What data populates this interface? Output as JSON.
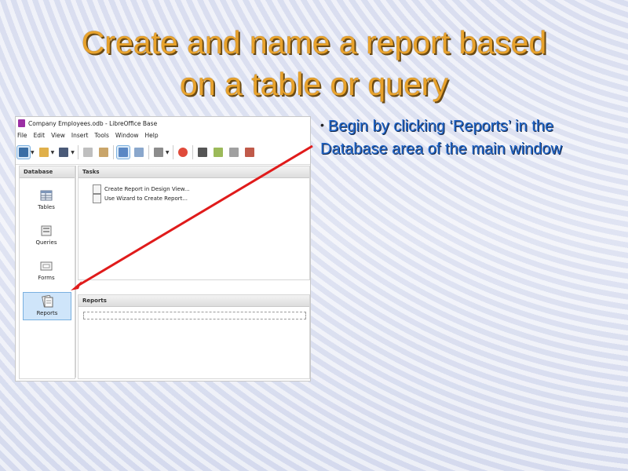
{
  "slide": {
    "title_line1": "Create and name a report based",
    "title_line2": "on a table or query",
    "bullet": "Begin by clicking ‘Reports’ in the Database area of the main window",
    "bullet_marker": "•",
    "accent_color": "#e8a22c",
    "bullet_color": "#1d63c7",
    "arrow_color": "#e01b1b"
  },
  "window": {
    "title": "Company Employees.odb - LibreOffice Base",
    "menu": [
      "File",
      "Edit",
      "View",
      "Insert",
      "Tools",
      "Window",
      "Help"
    ],
    "toolbar_icons": [
      "new-document-icon",
      "open-folder-icon",
      "save-icon",
      "copy-icon",
      "paste-icon",
      "sort-ascending-icon",
      "sort-icon",
      "form-icon",
      "help-icon",
      "report-icon",
      "edit-icon",
      "open-icon",
      "delete-icon"
    ]
  },
  "database_pane": {
    "header": "Database",
    "items": [
      {
        "label": "Tables",
        "icon": "tables-icon",
        "selected": false
      },
      {
        "label": "Queries",
        "icon": "queries-icon",
        "selected": false
      },
      {
        "label": "Forms",
        "icon": "forms-icon",
        "selected": false
      },
      {
        "label": "Reports",
        "icon": "reports-icon",
        "selected": true
      }
    ]
  },
  "tasks_pane": {
    "header": "Tasks",
    "items": [
      "Create Report in Design View...",
      "Use Wizard to Create Report..."
    ]
  },
  "reports_pane": {
    "header": "Reports"
  }
}
